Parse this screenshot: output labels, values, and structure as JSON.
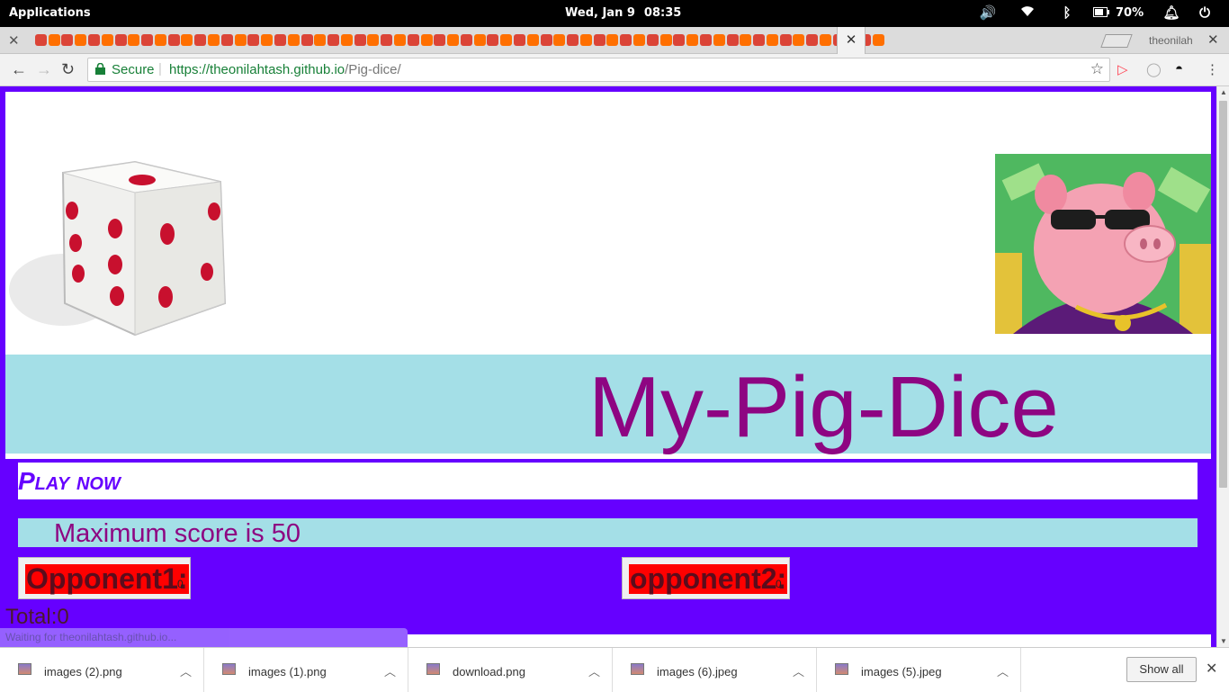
{
  "os": {
    "apps_label": "Applications",
    "date": "Wed, Jan  9",
    "time": "08:35",
    "battery": "70%"
  },
  "tabs": {
    "profile": "theonilah"
  },
  "address": {
    "secure_label": "Secure",
    "url_host": "https://theonilahtash.github.io",
    "url_path": "/Pig-dice/"
  },
  "page": {
    "title": "My-Pig-Dice",
    "play_label": "Play now",
    "max_score_text": "Maximum score is 50",
    "opponent1_label": "Opponent1:",
    "opponent1_score": "0",
    "opponent2_label": "opponent2:",
    "opponent2_score": "0",
    "total_text": "Total:0"
  },
  "status": "Waiting for theonilahtash.github.io...",
  "downloads": {
    "items": [
      {
        "name": "images (2).png"
      },
      {
        "name": "images (1).png"
      },
      {
        "name": "download.png"
      },
      {
        "name": "images (6).jpeg"
      },
      {
        "name": "images (5).jpeg"
      }
    ],
    "show_all": "Show all"
  },
  "colors": {
    "page_bg": "#6600ff",
    "band": "#a4dfe7",
    "title": "#8e0582",
    "opponent_bg": "#ff0000"
  }
}
